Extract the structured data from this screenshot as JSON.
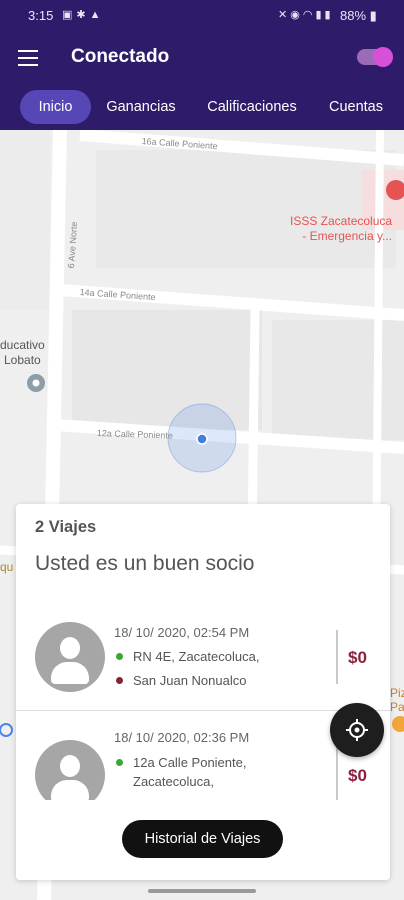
{
  "status_bar": {
    "time": "3:15",
    "left_icons": [
      "image-icon",
      "bug-icon",
      "warning-icon"
    ],
    "right_icons": [
      "mute-icon",
      "location-icon",
      "wifi-icon",
      "signal-icon",
      "signal-icon"
    ],
    "battery": "88%"
  },
  "app_bar": {
    "title": "Conectado",
    "online_toggle": true
  },
  "tabs": [
    {
      "label": "Inicio",
      "active": true
    },
    {
      "label": "Ganancias",
      "active": false
    },
    {
      "label": "Calificaciones",
      "active": false
    },
    {
      "label": "Cuentas",
      "active": false
    }
  ],
  "map": {
    "streets": [
      "16a Calle Poniente",
      "6 Ave Norte",
      "14a Calle Poniente",
      "12a Calle Poniente"
    ],
    "hospital_lines": [
      "ISSS Zacatecoluca",
      "- Emergencia y..."
    ],
    "school_lines": [
      "ducativo",
      "Lobato"
    ],
    "edge_fragments": [
      "qu",
      "Piz",
      "Pa"
    ],
    "colors": {
      "hospital": "#e55353",
      "location_accent": "#3f7fe0"
    }
  },
  "trips_card": {
    "count_label": "2 Viajes",
    "message": "Usted es un buen socio",
    "trips": [
      {
        "date": "18/ 10/ 2020, 02:54 PM",
        "origin": "RN 4E, Zacatecoluca,",
        "destination": "San Juan Nonualco",
        "price": "$0"
      },
      {
        "date": "18/ 10/ 2020, 02:36 PM",
        "origin": "12a Calle Poniente, Zacatecoluca,",
        "destination": "",
        "price": "$0"
      }
    ],
    "history_button": "Historial de Viajes"
  },
  "colors": {
    "app_bar": "#2e1c6b",
    "active_tab": "#5747b6",
    "price": "#8b1f3c",
    "origin_dot": "#38a82e",
    "destination_dot": "#8a2036"
  }
}
